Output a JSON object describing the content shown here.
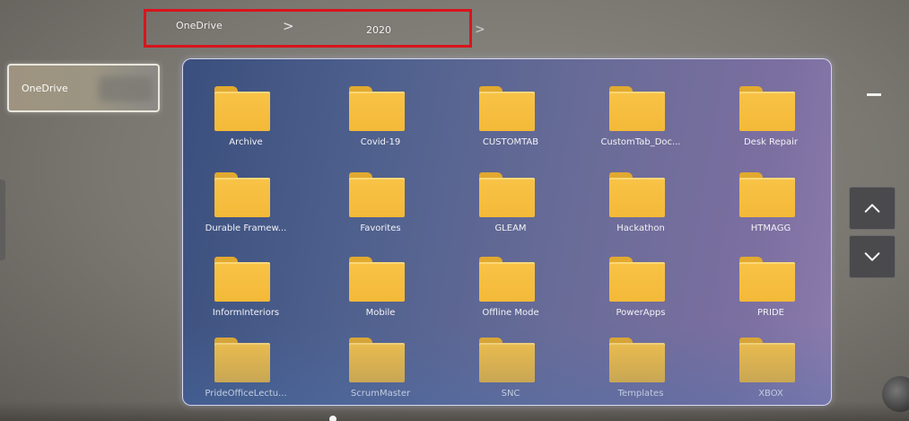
{
  "breadcrumb": {
    "root": "OneDrive",
    "separator": ">",
    "current": "2020"
  },
  "sidebar": {
    "items": [
      {
        "label": "OneDrive"
      }
    ]
  },
  "folders": [
    "Archive",
    "Covid-19",
    "CUSTOMTAB",
    "CustomTab_Doc...",
    "Desk Repair",
    "Durable Framew...",
    "Favorites",
    "GLEAM",
    "Hackathon",
    "HTMAGG",
    "InformInteriors",
    "Mobile",
    "Offline Mode",
    "PowerApps",
    "PRIDE",
    "PrideOfficeLectu...",
    "ScrumMaster",
    "SNC",
    "Templates",
    "XBOX"
  ],
  "controls": {
    "minimize_icon": "minimize-icon",
    "scroll_up_icon": "chevron-up-icon",
    "scroll_down_icon": "chevron-down-icon"
  },
  "colors": {
    "highlight_border": "#d8141c",
    "folder": "#f4b938",
    "panel": "#5a6590"
  }
}
